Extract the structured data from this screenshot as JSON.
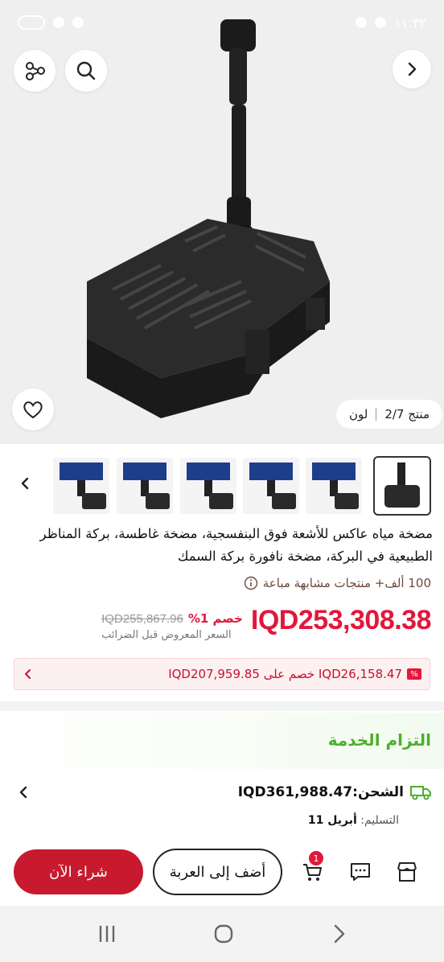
{
  "status_bar": {
    "time": "١١:٣٢"
  },
  "gallery": {
    "counter": "منتج 2/7",
    "variant_label": "لون",
    "thumbnail_count_note": ""
  },
  "product": {
    "title": "مضخة مياه عاكس للأشعة فوق البنفسجية، مضخة غاطسة، بركة المناظر الطبيعية في البركة، مضخة نافورة بركة السمك",
    "sold_text": "100 ألف+ منتجات مشابهة مباعة",
    "price": "IQD253,308.38",
    "discount": "خصم 1%",
    "old_price": "IQD255,867.96",
    "pretax_note": "السعر المعروض قبل الضرائب"
  },
  "coupon": {
    "text": "IQD26,158.47 خصم على IQD207,959.85"
  },
  "service": {
    "title": "التزام الخدمة"
  },
  "shipping": {
    "label": "الشحن:IQD361,988.47",
    "delivery_label": "التسليم:",
    "delivery_date": "أبريل 11"
  },
  "actions": {
    "buy_now": "شراء الآن",
    "add_to_cart": "أضف إلى العربة",
    "cart_badge": "1"
  },
  "colors": {
    "accent": "#e2173b",
    "buy_button": "#c81a2e",
    "service_green": "#4caf2d"
  }
}
